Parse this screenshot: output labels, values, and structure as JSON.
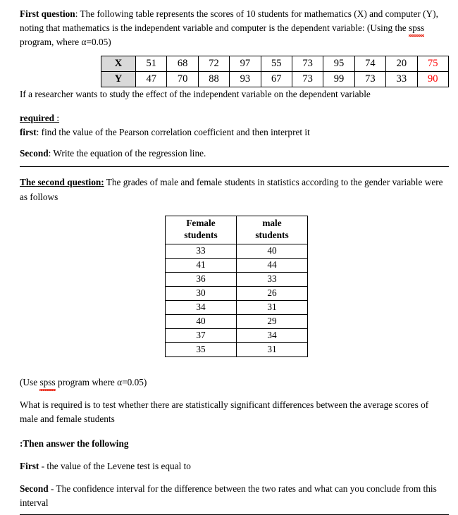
{
  "document": {
    "question1": {
      "heading": "First question",
      "intro_part1": ": The following table represents the scores of 10 students for mathematics (X) and computer (Y), noting that mathematics is the independent variable and computer is the dependent variable: (Using the ",
      "intro_spss": "spss",
      "intro_part2": " program, where α=0.05)",
      "after_table": "If a researcher wants to study the effect of the independent variable on the dependent variable",
      "required_label": "required",
      "required_colon": " :",
      "first_label": "first",
      "first_text": ": find the value of the Pearson correlation coefficient and then interpret it",
      "second_label": "Second",
      "second_text": ": Write the equation of the regression line."
    },
    "table1": {
      "row_labels": [
        "X",
        "Y"
      ],
      "x_values": [
        "51",
        "68",
        "72",
        "97",
        "55",
        "73",
        "95",
        "74",
        "20",
        "75"
      ],
      "y_values": [
        "47",
        "70",
        "88",
        "93",
        "67",
        "73",
        "99",
        "73",
        "33",
        "90"
      ],
      "highlight_color": "#ff0000",
      "header_bg": "#d9d9d9",
      "highlight_column_index": 9
    },
    "question2": {
      "heading": "The second question:",
      "intro": " The grades of male and female students in statistics according to the gender variable were as follows",
      "use_spss_part1": "(Use ",
      "use_spss_word": "spss",
      "use_spss_part2": " program where α=0.05)",
      "requirement": "What is required is to test whether there are statistically significant differences between the average scores of male and female students",
      "then_answer": ":Then answer the following",
      "first_label": "First",
      "first_text": " - the value of the Levene test is equal to",
      "second_label": "Second",
      "second_text": " - The confidence interval for the difference between the two rates and what can you conclude from this interval"
    },
    "table2": {
      "headers": [
        "Female students",
        "male students"
      ],
      "header_line1": [
        "Female",
        "male"
      ],
      "header_line2": [
        "students",
        "students"
      ],
      "rows": [
        [
          "33",
          "40"
        ],
        [
          "41",
          "44"
        ],
        [
          "36",
          "33"
        ],
        [
          "30",
          "26"
        ],
        [
          "34",
          "31"
        ],
        [
          "40",
          "29"
        ],
        [
          "37",
          "34"
        ],
        [
          "35",
          "31"
        ]
      ]
    }
  }
}
